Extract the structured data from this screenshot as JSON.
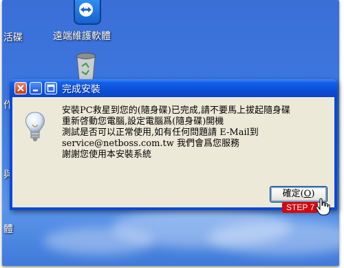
{
  "desktop": {
    "icons": [
      {
        "label": "遠端維護軟體"
      },
      {
        "label": ""
      }
    ],
    "edge_labels": [
      "活碟",
      "作",
      "與",
      "體"
    ]
  },
  "dialog": {
    "title": "完成安裝",
    "message_lines": [
      "安裝PC救星到您的(隨身碟)已完成,請不要馬上拔起隨身碟",
      "重新啓動您電腦,設定電腦爲(隨身碟)開機",
      "測試是否可以正常使用,如有任何問題請 E-Mail到",
      "service@netboss.com.tw 我們會爲您服務",
      "謝謝您使用本安裝系統"
    ],
    "ok_button": "確定(O)"
  },
  "overlay": {
    "step_badge": "STEP 7"
  },
  "colors": {
    "titlebar": "#0a4fd8",
    "dialog_body": "#ece9d8",
    "step_badge": "#d10a10"
  }
}
